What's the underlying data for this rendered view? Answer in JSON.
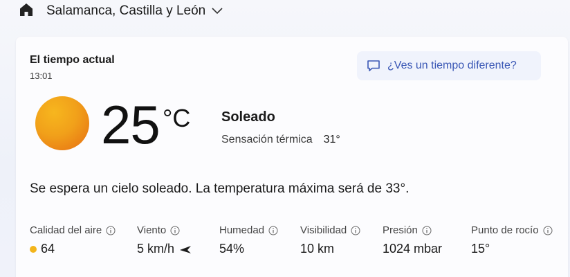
{
  "header": {
    "home_icon": "home-icon",
    "location": "Salamanca, Castilla y León",
    "dropdown_icon": "chevron-down-icon"
  },
  "card": {
    "title": "El tiempo actual",
    "time": "13:01",
    "feedback_label": "¿Ves un tiempo diferente?",
    "feedback_icon": "chat-icon",
    "weather_icon": "sun-icon",
    "temperature": "25",
    "unit": "°C",
    "condition": "Soleado",
    "feels_like_label": "Sensación térmica",
    "feels_like_value": "31°",
    "summary": "Se espera un cielo soleado. La temperatura máxima será de 33°."
  },
  "metrics": [
    {
      "label": "Calidad del aire",
      "value": "64",
      "indicator_color": "#f3b51b"
    },
    {
      "label": "Viento",
      "value": "5 km/h",
      "icon": "wind-direction-arrow-icon"
    },
    {
      "label": "Humedad",
      "value": "54%"
    },
    {
      "label": "Visibilidad",
      "value": "10 km"
    },
    {
      "label": "Presión",
      "value": "1024 mbar"
    },
    {
      "label": "Punto de rocío",
      "value": "15°"
    }
  ],
  "colors": {
    "accent": "#3a57b5",
    "sun_light": "#f7b61e",
    "sun_dark": "#e66c12",
    "card_background": "#fcfcfe"
  }
}
